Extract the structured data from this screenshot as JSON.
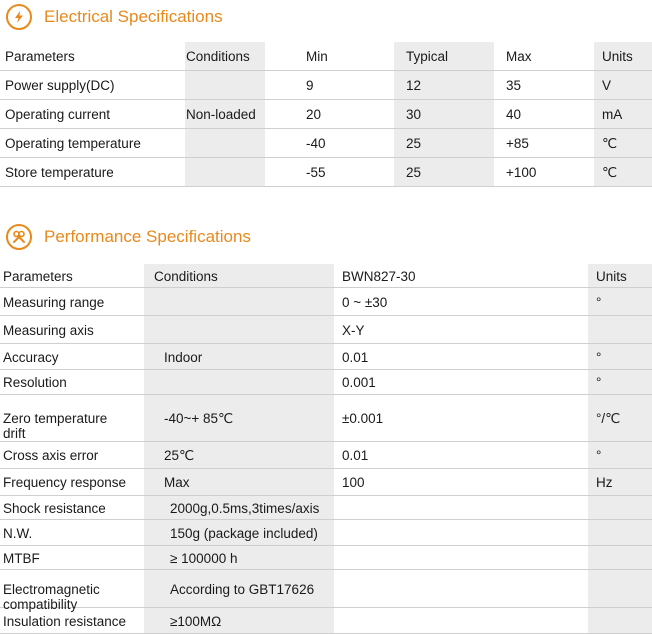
{
  "electrical": {
    "title": "Electrical Specifications",
    "icon": "lightning-icon",
    "headers": [
      "Parameters",
      "Conditions",
      "Min",
      "Typical",
      "Max",
      "Units"
    ],
    "rows": [
      [
        "Power supply(DC)",
        "",
        "9",
        "12",
        "35",
        "V"
      ],
      [
        "Operating  current",
        "Non-loaded",
        "20",
        "30",
        "40",
        "mA"
      ],
      [
        "Operating  temperature",
        "",
        "-40",
        "25",
        "+85",
        "℃"
      ],
      [
        "Store temperature",
        "",
        "-55",
        "25",
        "+100",
        "℃"
      ]
    ]
  },
  "performance": {
    "title": "Performance Specifications",
    "icon": "tools-icon",
    "headers": [
      "Parameters",
      "Conditions",
      "BWN827-30",
      "Units"
    ],
    "rows": [
      [
        "Measuring range",
        "",
        "0 ~ ±30",
        "°"
      ],
      [
        "Measuring axis",
        "",
        "X-Y",
        ""
      ],
      [
        "Accuracy",
        "Indoor",
        "0.01",
        "°"
      ],
      [
        "Resolution",
        "",
        "0.001",
        "°"
      ],
      [
        "Zero temperature drift",
        "-40~+ 85℃",
        "±0.001",
        "°/℃"
      ],
      [
        "Cross axis error",
        "25℃",
        "0.01",
        "°"
      ],
      [
        "Frequency response",
        "Max",
        "100",
        "Hz"
      ],
      [
        "Shock resistance",
        "2000g,0.5ms,3times/axis",
        "",
        ""
      ],
      [
        "N.W.",
        "150g (package included)",
        "",
        ""
      ],
      [
        "MTBF",
        "≥ 100000 h",
        "",
        ""
      ],
      [
        "Electromagnetic compatibility",
        "According to GBT17626",
        "",
        ""
      ],
      [
        "Insulation resistance",
        "≥100MΩ",
        "",
        ""
      ]
    ]
  },
  "colors": {
    "accent": "#e8891c",
    "shade": "#ececec"
  }
}
